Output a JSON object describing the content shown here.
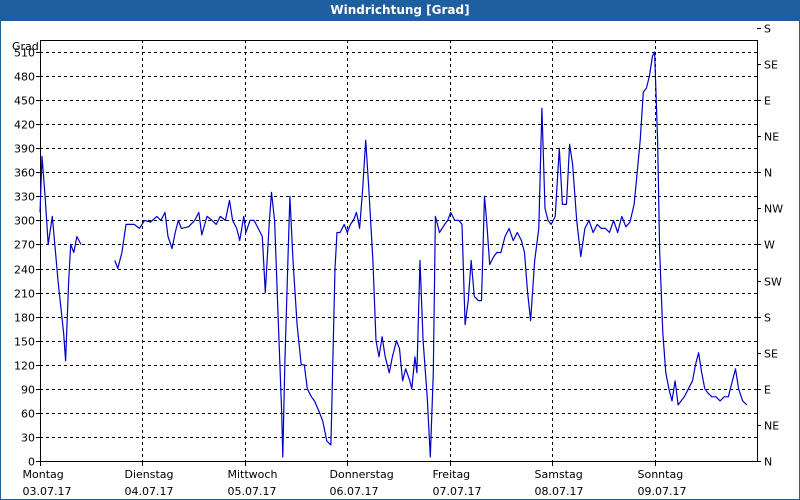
{
  "window": {
    "title": "Windrichtung [Grad]"
  },
  "chart_data": {
    "type": "line",
    "title": "Windrichtung [Grad]",
    "ylabel": "Grad",
    "ylim": [
      0,
      525
    ],
    "yticks": [
      0,
      30,
      60,
      90,
      120,
      150,
      180,
      210,
      240,
      270,
      300,
      330,
      360,
      390,
      420,
      450,
      480,
      510
    ],
    "right_ticks": [
      "N",
      "NE",
      "E",
      "SE",
      "S",
      "SW",
      "W",
      "NW",
      "N",
      "NE",
      "E",
      "SE",
      "S"
    ],
    "xlim": [
      0,
      7
    ],
    "x_labels": [
      {
        "day": "Montag",
        "date": "03.07.17"
      },
      {
        "day": "Dienstag",
        "date": "04.07.17"
      },
      {
        "day": "Mittwoch",
        "date": "05.07.17"
      },
      {
        "day": "Donnerstag",
        "date": "06.07.17"
      },
      {
        "day": "Freitag",
        "date": "07.07.17"
      },
      {
        "day": "Samstag",
        "date": "08.07.17"
      },
      {
        "day": "Sonntag",
        "date": "09.07.17"
      }
    ],
    "grid": true,
    "line_color": "#0000c8",
    "series": [
      {
        "segments": [
          [
            [
              0.0,
              310
            ],
            [
              0.02,
              380
            ],
            [
              0.05,
              330
            ],
            [
              0.08,
              270
            ],
            [
              0.12,
              305
            ],
            [
              0.18,
              220
            ],
            [
              0.23,
              160
            ],
            [
              0.25,
              125
            ],
            [
              0.28,
              225
            ],
            [
              0.3,
              270
            ],
            [
              0.33,
              260
            ],
            [
              0.36,
              280
            ],
            [
              0.4,
              270
            ]
          ],
          [
            [
              0.73,
              250
            ],
            [
              0.76,
              240
            ],
            [
              0.8,
              260
            ],
            [
              0.84,
              295
            ],
            [
              0.92,
              295
            ],
            [
              0.97,
              290
            ],
            [
              1.02,
              300
            ],
            [
              1.08,
              298
            ],
            [
              1.14,
              305
            ],
            [
              1.18,
              300
            ],
            [
              1.22,
              310
            ],
            [
              1.25,
              280
            ],
            [
              1.29,
              265
            ],
            [
              1.32,
              285
            ],
            [
              1.35,
              300
            ],
            [
              1.38,
              290
            ],
            [
              1.45,
              292
            ],
            [
              1.51,
              300
            ],
            [
              1.55,
              310
            ],
            [
              1.58,
              282
            ],
            [
              1.63,
              305
            ],
            [
              1.68,
              300
            ],
            [
              1.72,
              295
            ],
            [
              1.76,
              305
            ],
            [
              1.81,
              300
            ],
            [
              1.85,
              325
            ],
            [
              1.88,
              300
            ],
            [
              1.92,
              290
            ],
            [
              1.95,
              275
            ],
            [
              1.99,
              305
            ],
            [
              2.01,
              285
            ],
            [
              2.05,
              300
            ],
            [
              2.09,
              300
            ],
            [
              2.13,
              290
            ],
            [
              2.17,
              280
            ],
            [
              2.2,
              210
            ],
            [
              2.24,
              300
            ],
            [
              2.26,
              335
            ],
            [
              2.29,
              300
            ],
            [
              2.33,
              160
            ],
            [
              2.36,
              60
            ],
            [
              2.37,
              5
            ],
            [
              2.39,
              120
            ],
            [
              2.42,
              250
            ],
            [
              2.44,
              330
            ],
            [
              2.47,
              250
            ],
            [
              2.51,
              170
            ],
            [
              2.55,
              120
            ],
            [
              2.58,
              120
            ],
            [
              2.61,
              90
            ],
            [
              2.65,
              80
            ],
            [
              2.68,
              75
            ],
            [
              2.73,
              60
            ],
            [
              2.76,
              50
            ],
            [
              2.8,
              25
            ],
            [
              2.84,
              20
            ],
            [
              2.88,
              240
            ],
            [
              2.9,
              285
            ],
            [
              2.93,
              285
            ],
            [
              2.97,
              295
            ],
            [
              3.0,
              285
            ],
            [
              3.03,
              295
            ],
            [
              3.06,
              300
            ],
            [
              3.09,
              310
            ],
            [
              3.12,
              290
            ],
            [
              3.15,
              340
            ],
            [
              3.18,
              400
            ],
            [
              3.21,
              340
            ],
            [
              3.25,
              250
            ],
            [
              3.28,
              150
            ],
            [
              3.31,
              130
            ],
            [
              3.34,
              155
            ],
            [
              3.37,
              130
            ],
            [
              3.41,
              110
            ],
            [
              3.44,
              130
            ],
            [
              3.48,
              150
            ],
            [
              3.51,
              140
            ],
            [
              3.54,
              100
            ],
            [
              3.57,
              115
            ],
            [
              3.61,
              100
            ],
            [
              3.63,
              90
            ],
            [
              3.66,
              130
            ],
            [
              3.68,
              110
            ],
            [
              3.71,
              250
            ],
            [
              3.74,
              150
            ],
            [
              3.78,
              80
            ],
            [
              3.81,
              5
            ],
            [
              3.84,
              110
            ],
            [
              3.86,
              305
            ],
            [
              3.9,
              285
            ],
            [
              3.95,
              295
            ],
            [
              3.98,
              300
            ],
            [
              4.01,
              310
            ],
            [
              4.05,
              300
            ],
            [
              4.09,
              300
            ],
            [
              4.12,
              295
            ],
            [
              4.15,
              170
            ],
            [
              4.18,
              200
            ],
            [
              4.21,
              250
            ],
            [
              4.24,
              205
            ],
            [
              4.28,
              200
            ],
            [
              4.31,
              200
            ],
            [
              4.34,
              330
            ],
            [
              4.36,
              300
            ],
            [
              4.39,
              245
            ],
            [
              4.43,
              255
            ],
            [
              4.46,
              260
            ],
            [
              4.5,
              260
            ],
            [
              4.54,
              280
            ],
            [
              4.58,
              290
            ],
            [
              4.62,
              275
            ],
            [
              4.66,
              285
            ],
            [
              4.7,
              275
            ],
            [
              4.73,
              260
            ],
            [
              4.76,
              210
            ],
            [
              4.79,
              175
            ],
            [
              4.83,
              250
            ],
            [
              4.87,
              290
            ],
            [
              4.9,
              440
            ],
            [
              4.93,
              315
            ],
            [
              4.96,
              300
            ],
            [
              4.99,
              295
            ],
            [
              5.03,
              305
            ],
            [
              5.07,
              390
            ],
            [
              5.1,
              320
            ],
            [
              5.14,
              320
            ],
            [
              5.17,
              395
            ],
            [
              5.2,
              370
            ],
            [
              5.24,
              300
            ],
            [
              5.28,
              255
            ],
            [
              5.32,
              290
            ],
            [
              5.36,
              300
            ],
            [
              5.4,
              285
            ],
            [
              5.44,
              295
            ],
            [
              5.48,
              290
            ],
            [
              5.52,
              290
            ],
            [
              5.56,
              285
            ],
            [
              5.6,
              300
            ],
            [
              5.64,
              285
            ],
            [
              5.68,
              305
            ],
            [
              5.72,
              292
            ],
            [
              5.76,
              298
            ],
            [
              5.8,
              320
            ],
            [
              5.83,
              360
            ],
            [
              5.86,
              400
            ],
            [
              5.89,
              460
            ],
            [
              5.92,
              465
            ],
            [
              5.95,
              480
            ],
            [
              5.98,
              505
            ],
            [
              6.0,
              510
            ],
            [
              6.03,
              400
            ],
            [
              6.05,
              260
            ],
            [
              6.08,
              160
            ],
            [
              6.11,
              110
            ],
            [
              6.14,
              90
            ],
            [
              6.17,
              75
            ],
            [
              6.2,
              100
            ],
            [
              6.23,
              70
            ],
            [
              6.26,
              75
            ],
            [
              6.29,
              80
            ],
            [
              6.33,
              90
            ],
            [
              6.37,
              100
            ],
            [
              6.4,
              120
            ],
            [
              6.43,
              135
            ],
            [
              6.46,
              110
            ],
            [
              6.49,
              90
            ],
            [
              6.52,
              85
            ],
            [
              6.56,
              80
            ],
            [
              6.6,
              80
            ],
            [
              6.64,
              75
            ],
            [
              6.68,
              80
            ],
            [
              6.72,
              80
            ],
            [
              6.76,
              100
            ],
            [
              6.79,
              115
            ],
            [
              6.82,
              90
            ],
            [
              6.86,
              75
            ],
            [
              6.9,
              70
            ]
          ]
        ]
      }
    ]
  }
}
